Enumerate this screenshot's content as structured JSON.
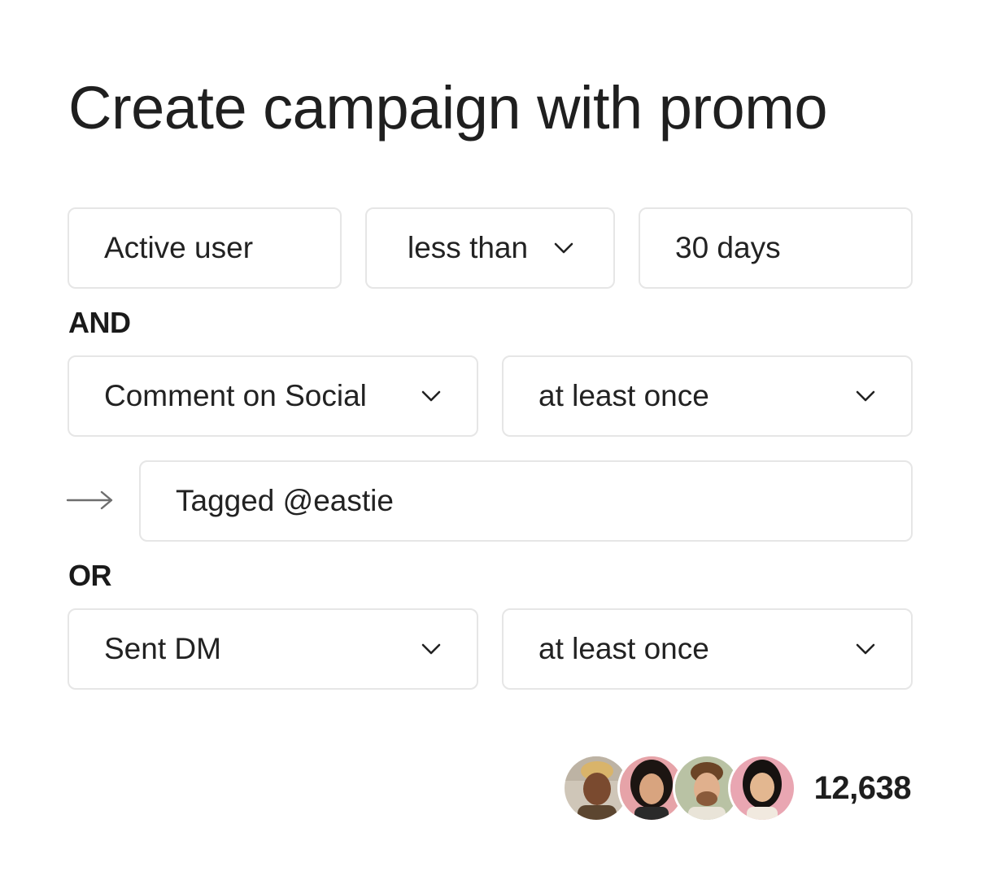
{
  "title": "Create campaign with promo",
  "rows": {
    "row1": {
      "attribute": "Active user",
      "comparator": "less than",
      "value": "30 days"
    },
    "and_label": "AND",
    "row2": {
      "event": "Comment on Social",
      "frequency": "at least once"
    },
    "sub_condition": "Tagged @eastie",
    "or_label": "OR",
    "row3": {
      "event": "Sent DM",
      "frequency": "at least once"
    }
  },
  "audience": {
    "count": "12,638",
    "avatars": [
      "avatar-1",
      "avatar-2",
      "avatar-3",
      "avatar-4"
    ]
  },
  "colors": {
    "border": "#e6e6e6",
    "text": "#222222",
    "background": "#ffffff"
  },
  "icons": {
    "caret": "chevron-down-icon",
    "arrow": "arrow-right-icon"
  }
}
